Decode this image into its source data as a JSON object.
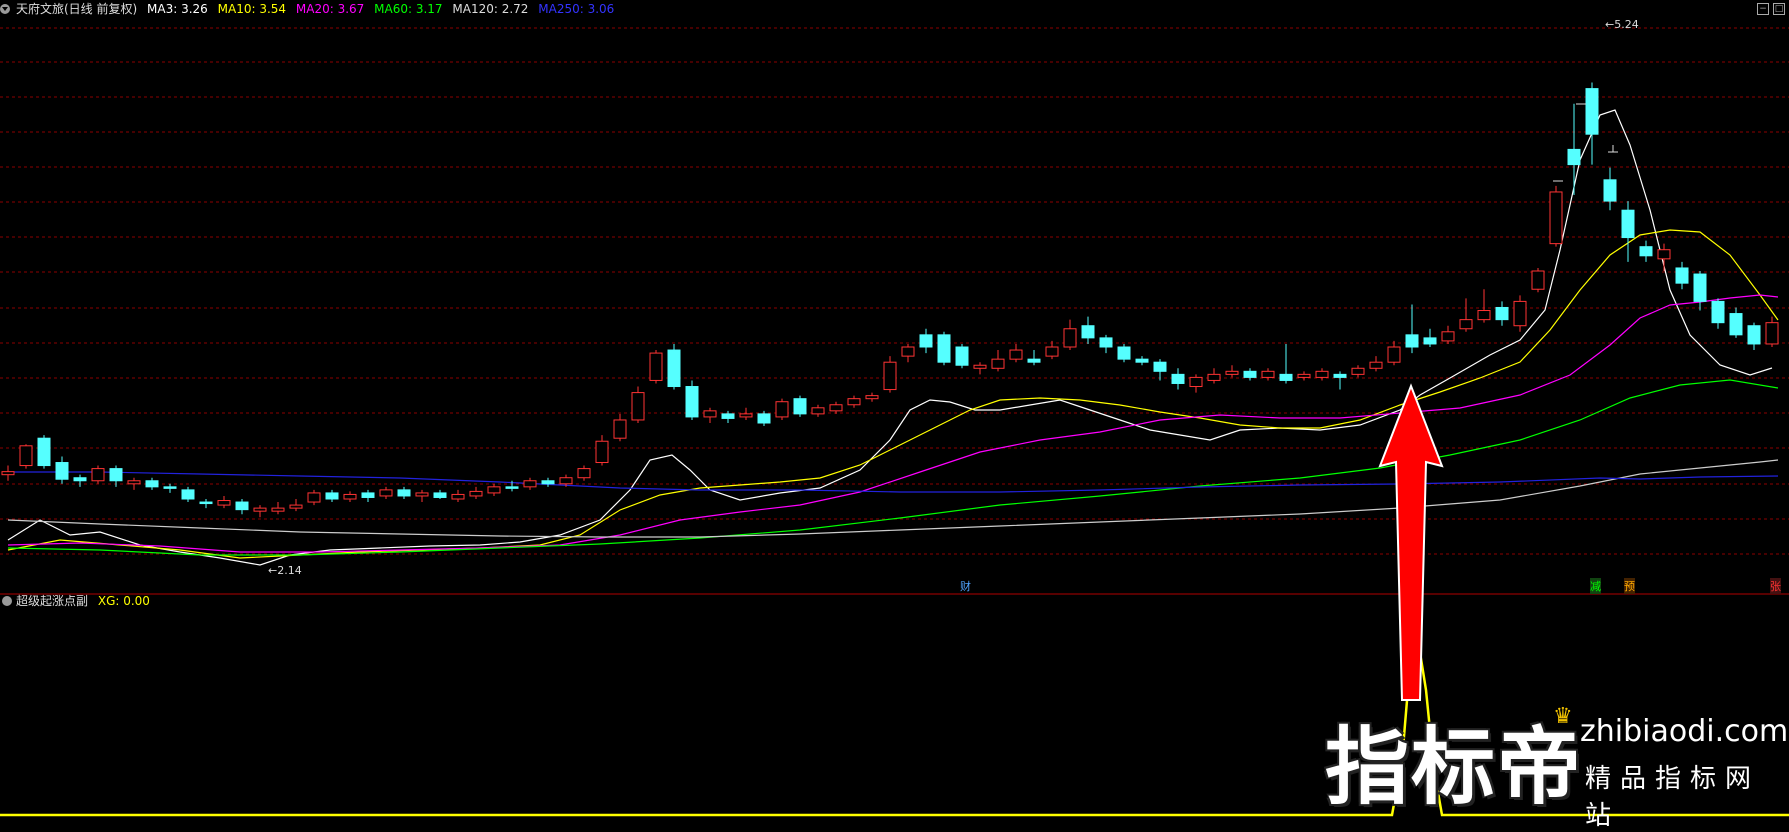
{
  "main_legend": {
    "stock_title": "天府文旅(日线 前复权)",
    "items": [
      {
        "label": "MA3: 3.26",
        "color": "#ffffff"
      },
      {
        "label": "MA10: 3.54",
        "color": "#ffff00"
      },
      {
        "label": "MA20: 3.67",
        "color": "#ff00ff"
      },
      {
        "label": "MA60: 3.17",
        "color": "#00ff00"
      },
      {
        "label": "MA120: 2.72",
        "color": "#dddddd"
      },
      {
        "label": "MA250: 3.06",
        "color": "#3333ff"
      }
    ]
  },
  "window_buttons": {
    "minimize": "−",
    "maximize": "□"
  },
  "price_labels": {
    "high": "5.24",
    "low": "2.14"
  },
  "event_markers": [
    {
      "text": "财",
      "color": "#4fa3ff"
    },
    {
      "text": "减",
      "color": "#00ff00"
    },
    {
      "text": "预",
      "color": "#ffaa00"
    },
    {
      "text": "张",
      "color": "#ff3333"
    }
  ],
  "sub_legend": {
    "indicator_name": "超级起涨点副",
    "value_label": "XG: 0.00",
    "value_color": "#ffff00"
  },
  "watermark": {
    "brand": "指标帝",
    "url": "zhibiaodi.com",
    "tagline": "精品指标网站"
  },
  "colors": {
    "up": "#ff3333",
    "down": "#55ffff",
    "grid": "#8b0000",
    "arrow": "#ff0000"
  }
}
